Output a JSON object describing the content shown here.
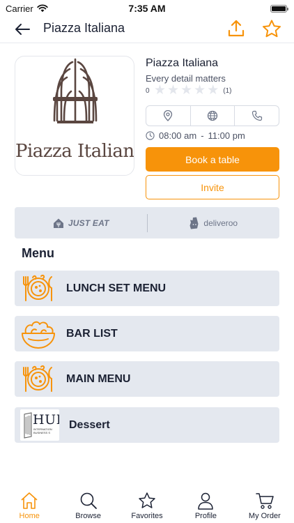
{
  "status_bar": {
    "carrier": "Carrier",
    "time": "7:35 AM"
  },
  "nav": {
    "title": "Piazza Italiana",
    "back_icon": "arrow-left-icon",
    "share_icon": "share-upload-icon",
    "favorite_icon": "star-outline-icon"
  },
  "restaurant": {
    "logo_text": "Piazza Italiana",
    "name": "Piazza Italiana",
    "tagline": "Every detail matters",
    "rating": "0",
    "rating_stars_filled": 0,
    "rating_stars_total": 5,
    "review_count": "(1)",
    "contact_icons": [
      "location-pin-icon",
      "globe-icon",
      "phone-icon"
    ],
    "hours_open": "08:00 am",
    "hours_separator": "-",
    "hours_close": "11:00 pm",
    "book_label": "Book a table",
    "invite_label": "Invite"
  },
  "delivery": {
    "partners": [
      {
        "name": "JUST EAT",
        "icon": "just-eat-house-icon"
      },
      {
        "name": "deliveroo",
        "icon": "deliveroo-kangaroo-icon"
      }
    ]
  },
  "menu": {
    "heading": "Menu",
    "items": [
      {
        "label": "LUNCH SET MENU",
        "icon": "plate-cutlery-icon"
      },
      {
        "label": "BAR LIST",
        "icon": "salad-bowl-icon"
      },
      {
        "label": "MAIN MENU",
        "icon": "plate-cutlery-icon"
      },
      {
        "label": "Dessert",
        "icon": "hult-logo-thumbnail",
        "thumb_text": "HUL",
        "thumb_subtext": [
          "INTERNATION",
          "BUSINESS S"
        ]
      }
    ]
  },
  "tab_bar": {
    "active": "Home",
    "tabs": [
      {
        "label": "Home",
        "icon": "home-icon"
      },
      {
        "label": "Browse",
        "icon": "search-icon"
      },
      {
        "label": "Favorites",
        "icon": "star-icon"
      },
      {
        "label": "Profile",
        "icon": "person-icon"
      },
      {
        "label": "My Order",
        "icon": "cart-icon"
      }
    ]
  },
  "colors": {
    "accent": "#f7930a",
    "text_dark": "#1b2133",
    "card_bg": "#e4e8ef"
  }
}
